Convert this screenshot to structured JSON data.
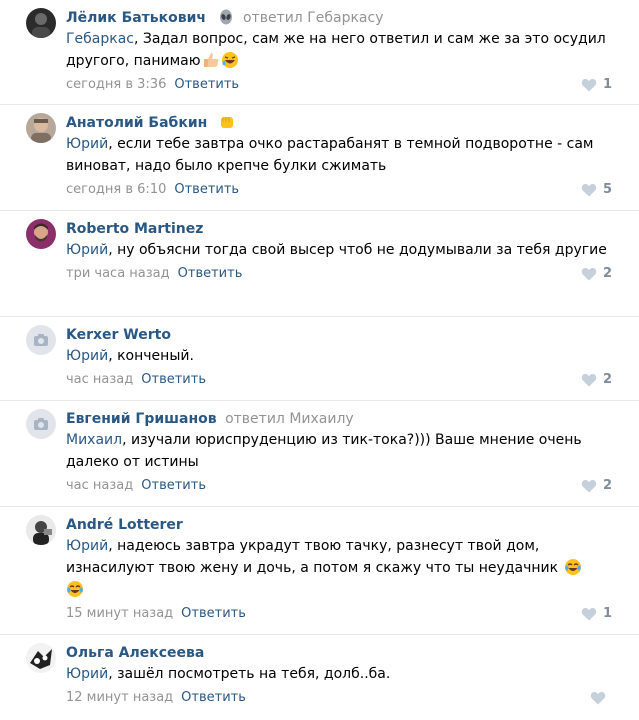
{
  "comments": [
    {
      "author": "Лёлик Батькович",
      "reply_to": "ответил Гебаркасу",
      "mention": "Гебаркас",
      "text": ", Задал вопрос, сам же на него ответил и сам же за это осудил другого, панимаю",
      "time": "сегодня в 3:36",
      "reply_label": "Ответить",
      "likes": "1",
      "badge": "alien-emoji",
      "emojis": [
        "thumbs-up-emoji",
        "rofl-emoji"
      ]
    },
    {
      "author": "Анатолий Бабкин",
      "reply_to": "",
      "mention": "Юрий",
      "text": ", если тебе завтра очко растарабанят в темной подворотне - сам виноват, надо было крепче булки сжимать",
      "time": "сегодня в 6:10",
      "reply_label": "Ответить",
      "likes": "5",
      "badge": "fist-emoji"
    },
    {
      "author": "Roberto Martinez",
      "reply_to": "",
      "mention": "Юрий",
      "text": ", ну объясни тогда свой высер чтоб не додумывали за тебя другие",
      "time": "три часа назад",
      "reply_label": "Ответить",
      "likes": "2"
    },
    {
      "author": "Kerxer Werto",
      "reply_to": "",
      "mention": "Юрий",
      "text": ", конченый.",
      "time": "час назад",
      "reply_label": "Ответить",
      "likes": "2"
    },
    {
      "author": "Евгений Гришанов",
      "reply_to": "ответил Михаилу",
      "mention": "Михаил",
      "text": ", изучали юриспруденцию из тик-тока?))) Ваше мнение очень далеко от истины",
      "time": "час назад",
      "reply_label": "Ответить",
      "likes": "2"
    },
    {
      "author": "André Lotterer",
      "reply_to": "",
      "mention": "Юрий",
      "text": ", надеюсь завтра украдут твою тачку, разнесут твой дом, изнасилуют твою жену и дочь, а потом я скажу что ты неудачник",
      "time": "15 минут назад",
      "reply_label": "Ответить",
      "likes": "1",
      "emojis": [
        "crying-laughing-emoji",
        "crying-laughing-emoji"
      ]
    },
    {
      "author": "Ольга Алексеева",
      "reply_to": "",
      "mention": "Юрий",
      "text": ", зашёл посмотреть на тебя, долб..ба.",
      "time": "12 минут назад",
      "reply_label": "Ответить",
      "likes": ""
    }
  ],
  "colors": {
    "link": "#2a5885",
    "meta": "#939393",
    "like": "#818c99",
    "divider": "#e7e8ec"
  }
}
